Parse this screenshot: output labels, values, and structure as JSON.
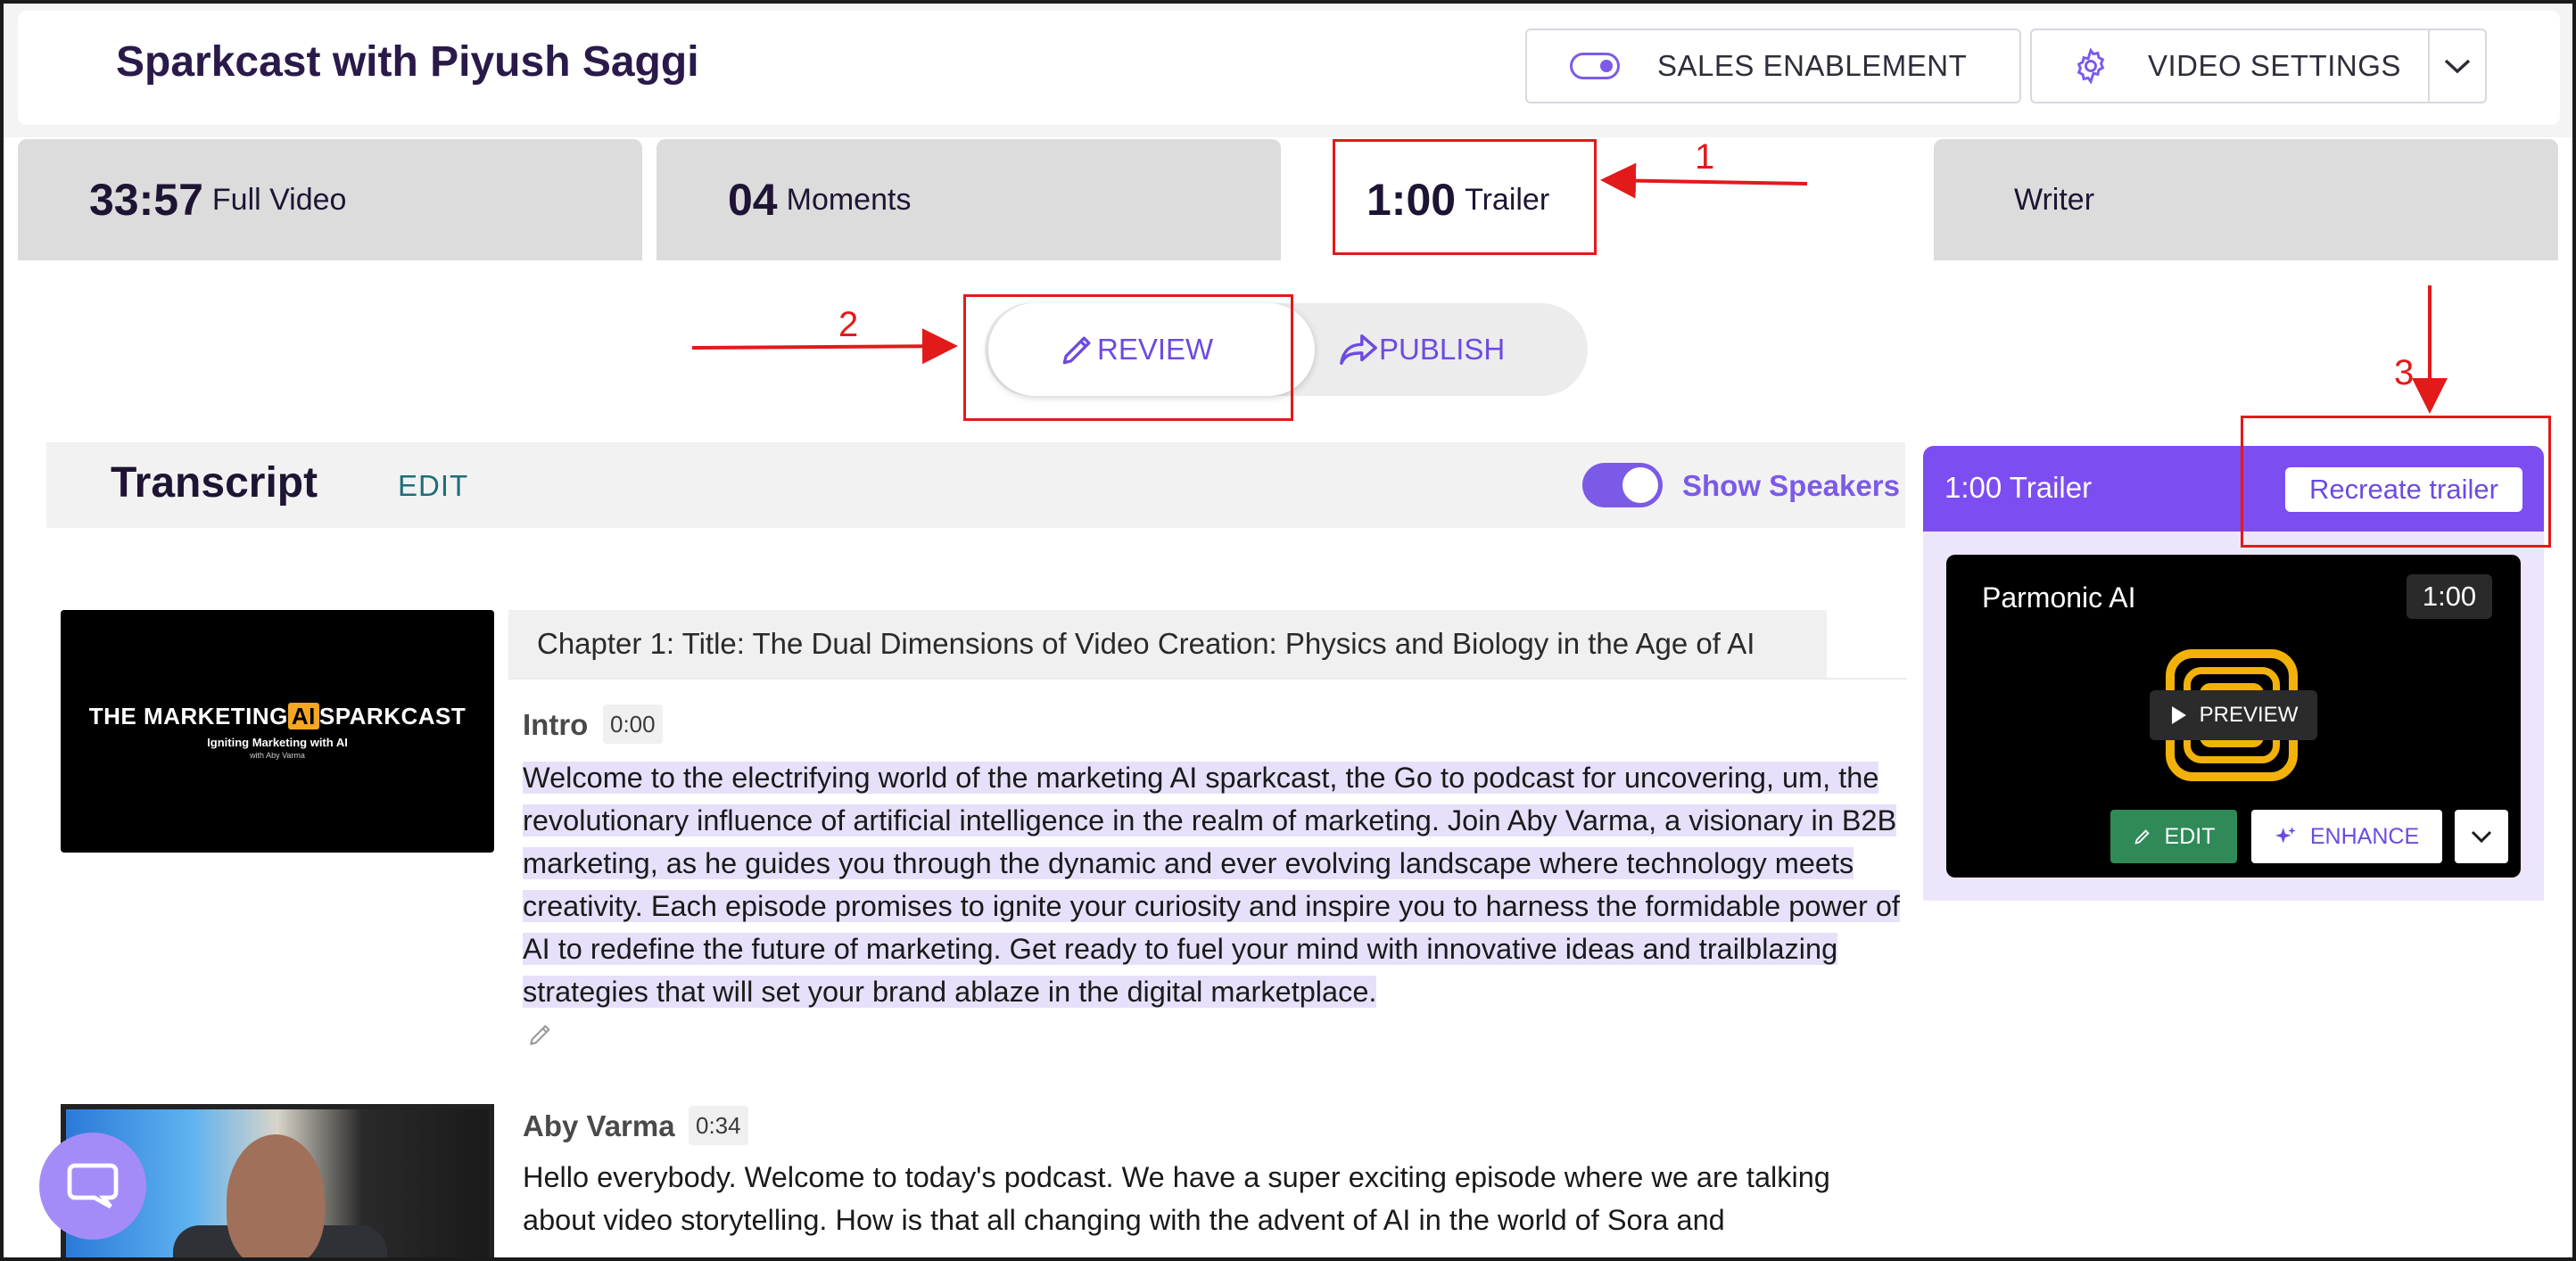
{
  "header": {
    "title": "Sparkcast with Piyush Saggi",
    "sales_enablement": "SALES ENABLEMENT",
    "video_settings": "VIDEO SETTINGS"
  },
  "tabs": [
    {
      "num": "33:57",
      "label": "Full Video"
    },
    {
      "num": "04",
      "label": "Moments"
    },
    {
      "num": "1:00",
      "label": "Trailer"
    },
    {
      "num": "",
      "label": "Writer"
    }
  ],
  "actions": {
    "review": "REVIEW",
    "publish": "PUBLISH"
  },
  "transcript": {
    "title": "Transcript",
    "edit": "EDIT",
    "show_speakers": "Show Speakers",
    "chapter": "Chapter 1: Title: The Dual Dimensions of Video Creation: Physics and Biology in the Age of AI",
    "thumb1": {
      "brand_left": "THE MARKETING",
      "brand_ai": "AI",
      "brand_right": "SPARKCAST",
      "tagline": "Igniting Marketing with AI",
      "byline": "with Aby Varma"
    },
    "entries": [
      {
        "speaker": "Intro",
        "time": "0:00",
        "text": "Welcome to the electrifying world of the marketing AI sparkcast, the Go to podcast for uncovering, um, the revolutionary influence of artificial intelligence in the realm of marketing. Join Aby Varma, a visionary in B2B marketing, as he guides you through the dynamic and ever evolving landscape where technology meets creativity. Each episode promises to ignite your curiosity and inspire you to harness the formidable power of AI to redefine the future of marketing. Get ready to fuel your mind with innovative ideas and trailblazing strategies that will set your brand ablaze in the digital marketplace."
      },
      {
        "speaker": "Aby Varma",
        "time": "0:34",
        "text": "Hello everybody. Welcome to today's podcast. We have a super exciting episode where we are talking about video storytelling. How is that all changing with the advent of AI in the world of Sora and"
      }
    ]
  },
  "trailer_panel": {
    "header": "1:00 Trailer",
    "recreate": "Recreate trailer",
    "card_title": "Parmonic AI",
    "duration": "1:00",
    "preview": "PREVIEW",
    "edit": "EDIT",
    "enhance": "ENHANCE"
  },
  "annotations": [
    "1",
    "2",
    "3"
  ],
  "colors": {
    "accent": "#7c4df0",
    "annotation": "#e21a1a",
    "edit_green": "#2f8a58",
    "logo": "#f2b20a"
  }
}
